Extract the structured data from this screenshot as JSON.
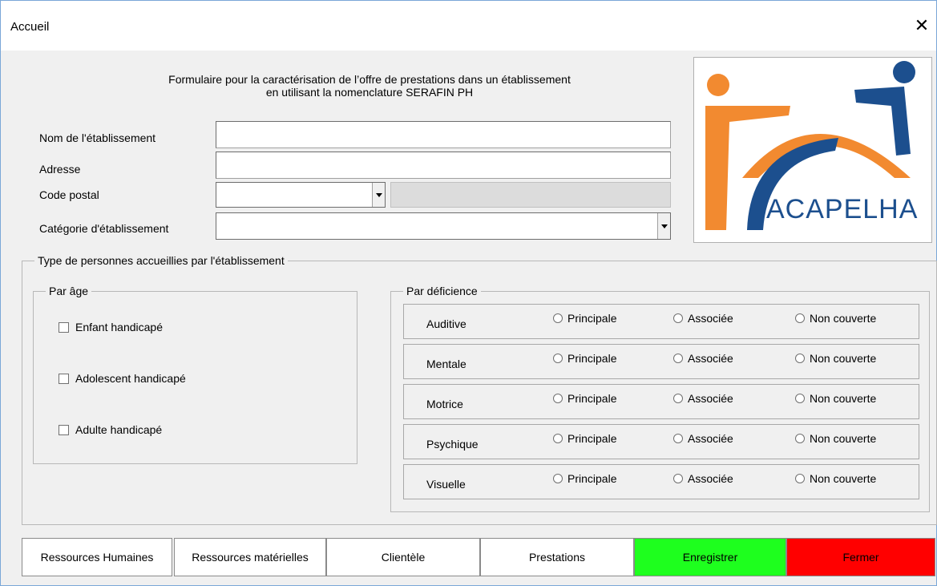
{
  "window": {
    "title": "Accueil"
  },
  "heading": {
    "line1": "Formulaire pour la caractérisation de l’offre de prestations dans un établissement",
    "line2": "en utilisant la nomenclature SERAFIN PH"
  },
  "fields": {
    "nom_label": "Nom de l'établissement",
    "nom_value": "",
    "adresse_label": "Adresse",
    "adresse_value": "",
    "code_postal_label": "Code postal",
    "code_postal_value": "",
    "categorie_label": "Catégorie d'établissement",
    "categorie_value": ""
  },
  "logo": {
    "text": "ACAPELHA",
    "colors": {
      "orange": "#f28a30",
      "blue": "#1c4f8e"
    }
  },
  "type_personnes": {
    "title": "Type de personnes accueillies par l'établissement",
    "par_age": {
      "title": "Par âge",
      "items": [
        "Enfant handicapé",
        "Adolescent handicapé",
        "Adulte handicapé"
      ]
    },
    "par_deficience": {
      "title": "Par déficience",
      "options": [
        "Principale",
        "Associée",
        "Non couverte"
      ],
      "rows": [
        "Auditive",
        "Mentale",
        "Motrice",
        "Psychique",
        "Visuelle"
      ]
    }
  },
  "buttons": {
    "ressources_humaines": "Ressources Humaines",
    "ressources_materielles": "Ressources matérielles",
    "clientele": "Clientèle",
    "prestations": "Prestations",
    "enregistrer": "Enregistrer",
    "fermer": "Fermer",
    "colors": {
      "enregistrer": "#1eff1e",
      "fermer": "#ff0000"
    }
  }
}
